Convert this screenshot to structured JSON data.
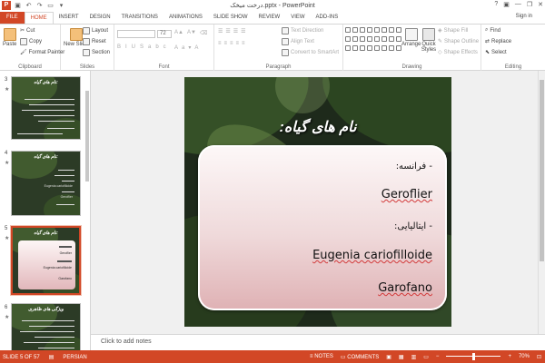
{
  "window": {
    "title": "درخت میخک.pptx - PowerPoint",
    "app_logo": "P",
    "help": "?",
    "minimize": "—",
    "restore": "❐",
    "close": "✕",
    "sign_in": "Sign in"
  },
  "tabs": [
    "FILE",
    "HOME",
    "INSERT",
    "DESIGN",
    "TRANSITIONS",
    "ANIMATIONS",
    "SLIDE SHOW",
    "REVIEW",
    "VIEW",
    "ADD-INS"
  ],
  "ribbon": {
    "clipboard": {
      "label": "Clipboard",
      "paste": "Paste",
      "cut": "Cut",
      "copy": "Copy",
      "format_painter": "Format Painter"
    },
    "slides": {
      "label": "Slides",
      "new_slide": "New Slide",
      "layout": "Layout",
      "reset": "Reset",
      "section": "Section"
    },
    "font": {
      "label": "Font",
      "size": "72"
    },
    "paragraph": {
      "label": "Paragraph",
      "text_direction": "Text Direction",
      "align_text": "Align Text",
      "convert_smartart": "Convert to SmartArt"
    },
    "drawing": {
      "label": "Drawing",
      "arrange": "Arrange",
      "quick_styles": "Quick Styles",
      "shape_fill": "Shape Fill",
      "shape_outline": "Shape Outline",
      "shape_effects": "Shape Effects"
    },
    "editing": {
      "label": "Editing",
      "find": "Find",
      "replace": "Replace",
      "select": "Select"
    }
  },
  "thumbnails": [
    {
      "num": "3",
      "star": "★",
      "title": "نام های گیاه:"
    },
    {
      "num": "4",
      "star": "★",
      "title": "نام های گیاه:",
      "lines": [
        "Eugenia cariofilloide",
        "Geroflier"
      ]
    },
    {
      "num": "5",
      "star": "★",
      "title": "نام های گیاه:",
      "lines": [
        "Geroflier",
        "Eugenia cariofilloide",
        "Garofano"
      ]
    },
    {
      "num": "6",
      "star": "★",
      "title": "ویژگی های ظاهری"
    }
  ],
  "slide": {
    "title": "نام های گیاه:",
    "items": [
      {
        "label": "- فرانسه:",
        "value": "Geroflier"
      },
      {
        "label": "- ایتالیایی:",
        "value": "Eugenia cariofilloide"
      },
      {
        "label": "",
        "value": "Garofano"
      }
    ]
  },
  "notes_placeholder": "Click to add notes",
  "status": {
    "slide_counter": "SLIDE 5 OF 57",
    "language": "PERSIAN",
    "notes": "NOTES",
    "comments": "COMMENTS",
    "zoom": "70%"
  },
  "colors": {
    "accent": "#d24726",
    "box_top": "#fdf8f8",
    "box_bottom": "#dfb1b4"
  }
}
